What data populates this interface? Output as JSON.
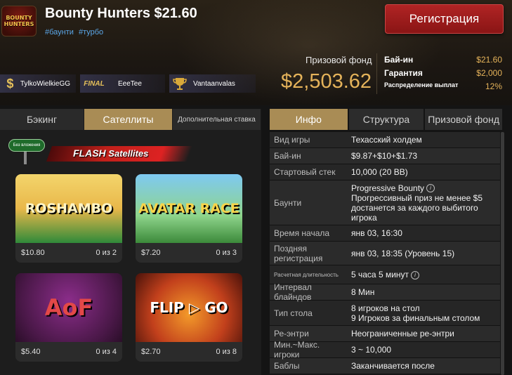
{
  "header": {
    "logo_text": [
      "BOUNTY",
      "HUNTERS"
    ],
    "title": "Bounty Hunters $21.60",
    "tags": [
      "#баунти",
      "#турбо"
    ],
    "register_label": "Регистрация",
    "prize_pool_label": "Призовой фонд",
    "prize_pool_value": "$2,503.62",
    "buyin_label": "Бай-ин",
    "buyin_value": "$21.60",
    "guarantee_label": "Гарантия",
    "guarantee_value": "$2,000",
    "payout_label": "Распределение выплат",
    "payout_value": "12%"
  },
  "players": [
    {
      "icon": "$",
      "name": "TylkoWielkieGG"
    },
    {
      "icon": "FINAL",
      "name": "EeeTee"
    },
    {
      "icon": "trophy",
      "name": "Vantaanvalas"
    }
  ],
  "left_tabs": [
    "Бэкинг",
    "Сателлиты",
    "Дополнительная ставка"
  ],
  "flash": {
    "badge": "Без вложения",
    "title_flash": "FLASH",
    "title_rest": "Satellites"
  },
  "satellites": [
    {
      "art": "ROSHAMBO",
      "price": "$10.80",
      "count": "0 из 2"
    },
    {
      "art": "AVATAR RACE",
      "price": "$7.20",
      "count": "0 из 3"
    },
    {
      "art": "AoF",
      "price": "$5.40",
      "count": "0 из 4"
    },
    {
      "art": "FLIP ▷ GO",
      "price": "$2.70",
      "count": "0 из 8"
    }
  ],
  "right_tabs": [
    "Инфо",
    "Структура",
    "Призовой фонд"
  ],
  "info_rows": [
    {
      "k": "Вид игры",
      "v": [
        "Техасский холдем"
      ]
    },
    {
      "k": "Бай-ин",
      "v": [
        "$9.87+$10+$1.73"
      ]
    },
    {
      "k": "Стартовый стек",
      "v": [
        "10,000 (20 BB)"
      ]
    },
    {
      "k": "Баунти",
      "v": [
        "Progressive Bounty",
        "Прогрессивный приз не менее $5",
        "достанется за каждого выбитого",
        "игрока"
      ]
    },
    {
      "k": "Время начала",
      "v": [
        "янв 03, 16:30"
      ]
    },
    {
      "k": "Поздняя регистрация",
      "v": [
        "янв 03, 18:35 (Уровень 15)"
      ]
    },
    {
      "k": "Расчетная длительность",
      "v": [
        "5 часа 5 минут"
      ]
    },
    {
      "k": "Интервал блайндов",
      "v": [
        "8 Мин"
      ]
    },
    {
      "k": "Тип стола",
      "v": [
        "8 игроков на стол",
        "9 Игроков за финальным столом"
      ]
    },
    {
      "k": "Ре-энтри",
      "v": [
        "Неограниченные ре-энтри"
      ]
    },
    {
      "k": "Мин.~Макс. игроки",
      "v": [
        "3 ~ 10,000"
      ]
    },
    {
      "k": "Баблы",
      "v": [
        "Заканчивается после"
      ]
    }
  ]
}
